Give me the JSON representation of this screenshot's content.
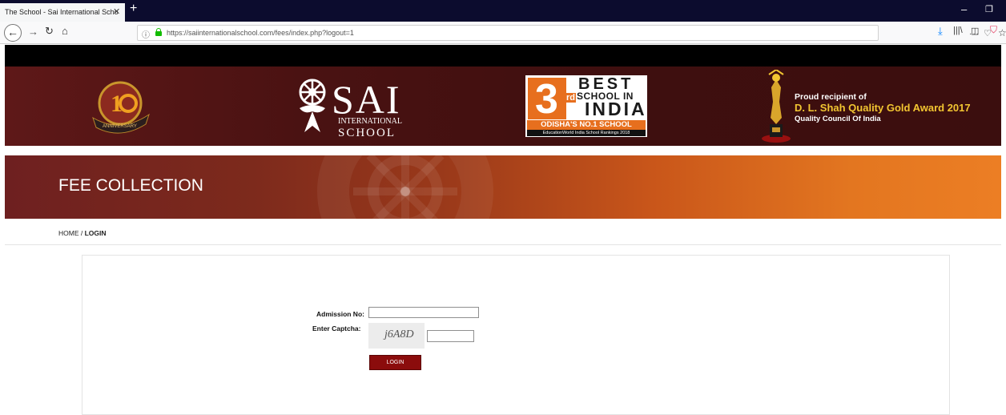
{
  "browser": {
    "tab_title": "The School - Sai International Scho",
    "tab_close": "✕",
    "new_tab": "+",
    "min": "–",
    "max": "❐",
    "url": "https://saiinternationalschool.com/fees/index.php?logout=1",
    "url_menu": "···"
  },
  "header": {
    "sai_big": "SAI",
    "sai_intl": "INTERNATIONAL",
    "sai_school": "SCHOOL",
    "badge_num": "3",
    "badge_rd": "rd",
    "badge_best": "BEST",
    "badge_school": "SCHOOL IN",
    "badge_india": "INDIA",
    "badge_odisha": "ODISHA'S NO.1 SCHOOL",
    "badge_rank": "EducationWorld India School Rankings 2018",
    "award_proud": "Proud recipient of",
    "award_name": "D. L. Shah Quality Gold Award 2017",
    "award_qci": "Quality Council Of India",
    "anniv_text": "ANNIVERSARY"
  },
  "banner": {
    "title": "FEE COLLECTION"
  },
  "breadcrumb": {
    "home": "HOME",
    "sep": " / ",
    "current": "LOGIN"
  },
  "form": {
    "admission_label": "Admission No:",
    "admission_value": "",
    "captcha_label": "Enter Captcha:",
    "captcha_text": "j6A8D",
    "captcha_value": "",
    "login_label": "LOGIN"
  },
  "colors": {
    "header_bg": "#4a1212",
    "banner_start": "#6e2020",
    "banner_end": "#ec7e24",
    "login_button": "#8b0c0c",
    "award_gold": "#f2c531",
    "badge_orange": "#e76f1e"
  }
}
